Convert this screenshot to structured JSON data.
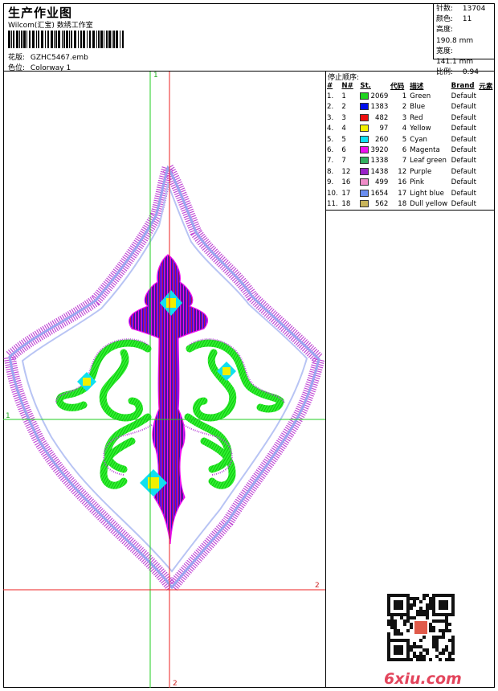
{
  "header": {
    "title": "生产作业图",
    "studio": "Wilcom(汇宝) 数绣工作室",
    "design_label": "花版:",
    "design_file": "GZHC5467.emb",
    "colorway_label": "色位:",
    "colorway": "Colorway 1"
  },
  "stats": [
    {
      "label": "针数:",
      "value": "13704"
    },
    {
      "label": "颜色:",
      "value": "11"
    },
    {
      "label": "高度:",
      "value": "190.8 mm"
    },
    {
      "label": "宽度:",
      "value": "141.1 mm"
    },
    {
      "label": "比例:",
      "value": "0.94"
    }
  ],
  "stop_sequence": {
    "title": "停止顺序:",
    "columns": [
      "#",
      "N#",
      "St.",
      "代码",
      "描述",
      "Brand",
      "元素"
    ],
    "rows": [
      {
        "n": "1.",
        "needle": "1",
        "color": "#1ed41e",
        "st": "2069",
        "code": "1",
        "desc": "Green",
        "brand": "Default"
      },
      {
        "n": "2.",
        "needle": "2",
        "color": "#0010ee",
        "st": "1383",
        "code": "2",
        "desc": "Blue",
        "brand": "Default"
      },
      {
        "n": "3.",
        "needle": "3",
        "color": "#ee1010",
        "st": "482",
        "code": "3",
        "desc": "Red",
        "brand": "Default"
      },
      {
        "n": "4.",
        "needle": "4",
        "color": "#f2f000",
        "st": "97",
        "code": "4",
        "desc": "Yellow",
        "brand": "Default"
      },
      {
        "n": "5.",
        "needle": "5",
        "color": "#10e0f0",
        "st": "260",
        "code": "5",
        "desc": "Cyan",
        "brand": "Default"
      },
      {
        "n": "6.",
        "needle": "6",
        "color": "#ee10ee",
        "st": "3920",
        "code": "6",
        "desc": "Magenta",
        "brand": "Default"
      },
      {
        "n": "7.",
        "needle": "7",
        "color": "#34b060",
        "st": "1338",
        "code": "7",
        "desc": "Leaf green",
        "brand": "Default"
      },
      {
        "n": "8.",
        "needle": "12",
        "color": "#9a22c8",
        "st": "1438",
        "code": "12",
        "desc": "Purple",
        "brand": "Default"
      },
      {
        "n": "9.",
        "needle": "16",
        "color": "#f08cc8",
        "st": "499",
        "code": "16",
        "desc": "Pink",
        "brand": "Default"
      },
      {
        "n": "10.",
        "needle": "17",
        "color": "#6a8ef0",
        "st": "1654",
        "code": "17",
        "desc": "Light blue",
        "brand": "Default"
      },
      {
        "n": "11.",
        "needle": "18",
        "color": "#c8b45a",
        "st": "562",
        "code": "18",
        "desc": "Dull yellow",
        "brand": "Default"
      }
    ]
  },
  "guides": {
    "v_green": "1",
    "h_green": "1",
    "v_red": "2",
    "h_red": "2"
  },
  "watermark": "6xiu.com"
}
